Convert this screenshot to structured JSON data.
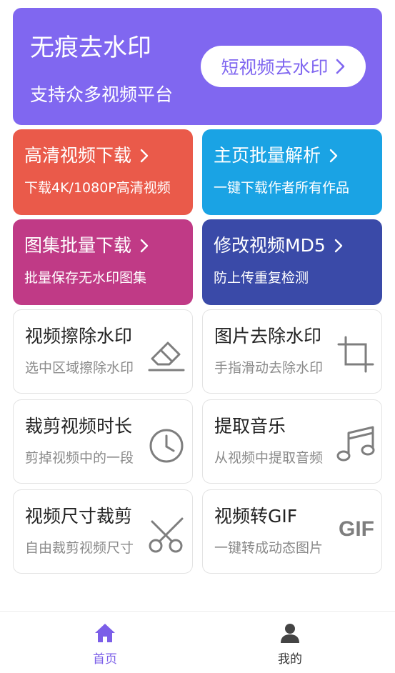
{
  "hero": {
    "title": "无痕去水印",
    "subtitle": "支持众多视频平台",
    "button_label": "短视频去水印"
  },
  "feature_tiles": [
    {
      "title": "高清视频下载",
      "subtitle": "下载4K/1080P高清视频",
      "color": "#ea5a4a"
    },
    {
      "title": "主页批量解析",
      "subtitle": "一键下载作者所有作品",
      "color": "#1aa3e4"
    },
    {
      "title": "图集批量下载",
      "subtitle": "批量保存无水印图集",
      "color": "#c03a86"
    },
    {
      "title": "修改视频MD5",
      "subtitle": "防上传重复检测",
      "color": "#3a4aa8"
    }
  ],
  "tools": [
    {
      "title": "视频擦除水印",
      "subtitle": "选中区域擦除水印",
      "icon": "eraser-icon"
    },
    {
      "title": "图片去除水印",
      "subtitle": "手指滑动去除水印",
      "icon": "crop-icon"
    },
    {
      "title": "裁剪视频时长",
      "subtitle": "剪掉视频中的一段",
      "icon": "clock-icon"
    },
    {
      "title": "提取音乐",
      "subtitle": "从视频中提取音频",
      "icon": "music-note-icon"
    },
    {
      "title": "视频尺寸裁剪",
      "subtitle": "自由裁剪视频尺寸",
      "icon": "scissors-icon"
    },
    {
      "title": "视频转GIF",
      "subtitle": "一键转成动态图片",
      "icon": "gif-icon",
      "icon_text": "GIF"
    }
  ],
  "tabbar": {
    "home_label": "首页",
    "mine_label": "我的",
    "active_color": "#7b5ee8"
  }
}
